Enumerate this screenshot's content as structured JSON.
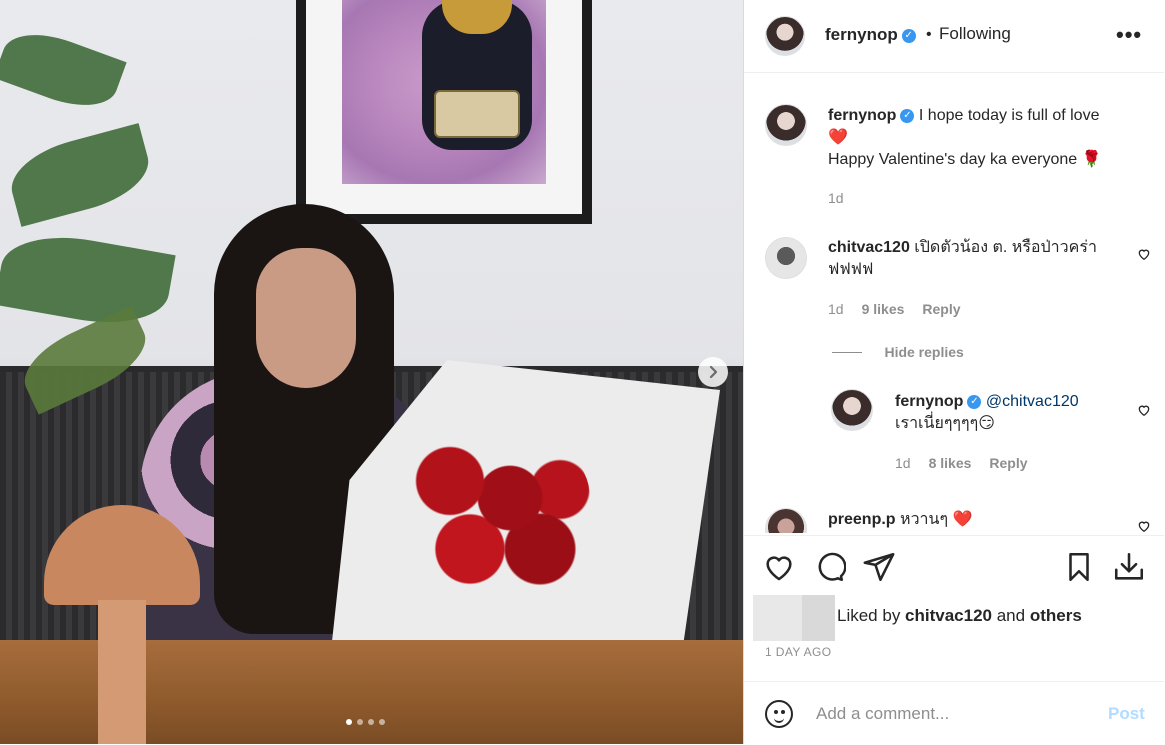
{
  "photo": {
    "carousel_count": 4,
    "active_index": 0
  },
  "header": {
    "username": "fernynop",
    "separator": "•",
    "follow_status": "Following",
    "more": "•••"
  },
  "caption": {
    "username": "fernynop",
    "line1": "I hope today is full of love",
    "heart": "❤️",
    "line2": "Happy Valentine's day ka everyone 🌹",
    "time": "1d"
  },
  "comments": [
    {
      "username": "chitvac120",
      "text": "เปิดตัวน้อง ต. หรือป่าวคร่า ฟฟฟฟ",
      "time": "1d",
      "likes": "9 likes",
      "reply": "Reply",
      "hide_replies": "Hide replies",
      "replies": [
        {
          "username": "fernynop",
          "mention": "@chitvac120",
          "text": "เราเนี่ยๆๆๆๆ😏",
          "time": "1d",
          "likes": "8 likes",
          "reply": "Reply"
        }
      ]
    },
    {
      "username": "preenp.p",
      "text": "หวานๆ ❤️"
    }
  ],
  "actions": {
    "liked_prefix": "Liked by ",
    "liked_user": "chitvac120",
    "liked_and": " and ",
    "liked_others": "others",
    "time_ago": "1 DAY AGO"
  },
  "add_comment": {
    "placeholder": "Add a comment...",
    "post_label": "Post"
  },
  "colors": {
    "verified": "#3897f0",
    "mention": "#00376b",
    "post_disabled": "#b3dbff",
    "heart": "#ed4956"
  }
}
